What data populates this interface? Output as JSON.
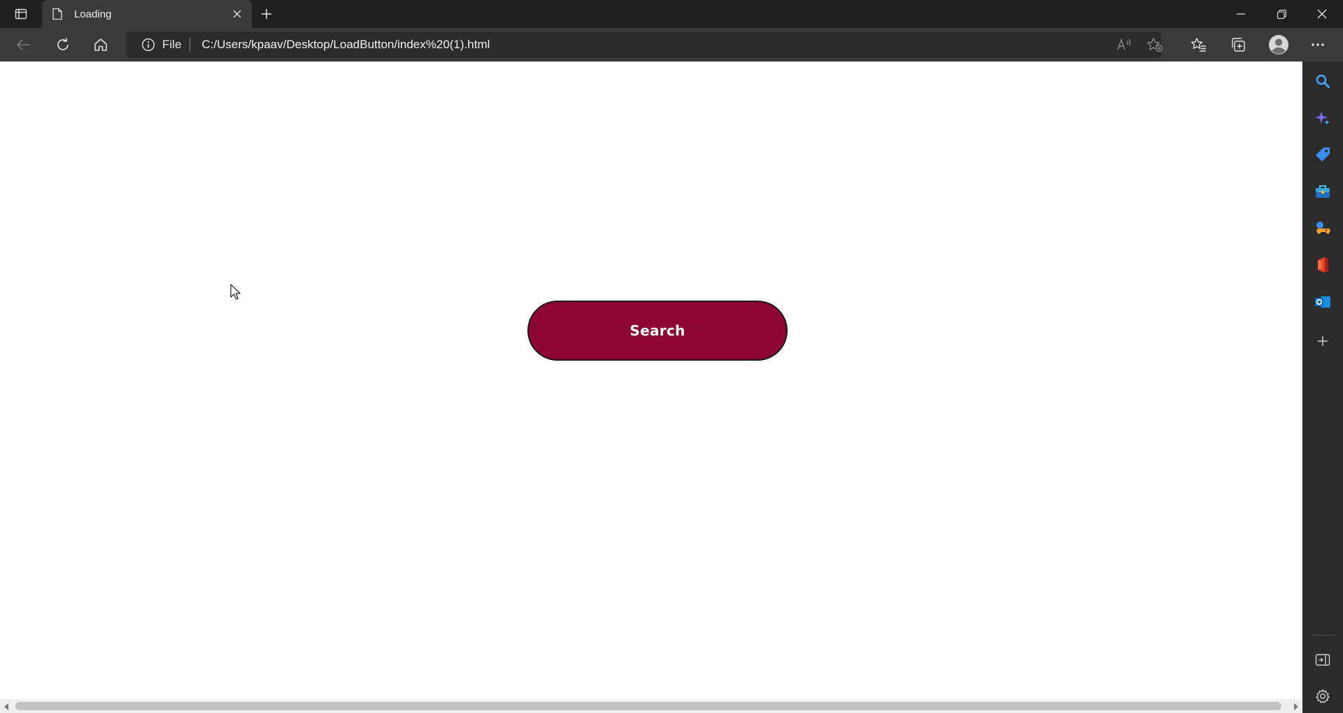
{
  "browser": {
    "tab": {
      "title": "Loading"
    },
    "address": {
      "scheme_label": "File",
      "url": "C:/Users/kpaav/Desktop/LoadButton/index%20(1).html"
    },
    "icons": {
      "tab_actions": "tab-actions-icon",
      "page": "page-icon",
      "close_tab": "close-icon",
      "new_tab": "plus-icon",
      "minimize": "minimize-icon",
      "restore": "restore-icon",
      "close_window": "close-icon",
      "back": "back-arrow-icon",
      "refresh": "refresh-icon",
      "home": "home-icon",
      "info": "info-icon",
      "read_aloud": "read-aloud-icon",
      "add_favorite": "star-plus-icon",
      "favorites": "favorites-icon",
      "collections": "collections-icon",
      "profile": "profile-icon",
      "more": "more-icon"
    },
    "sidebar_icons": [
      "search-icon",
      "copilot-icon",
      "shopping-tag-icon",
      "tools-icon",
      "games-icon",
      "office-icon",
      "outlook-icon",
      "add-icon",
      "hide-sidebar-icon",
      "settings-icon"
    ]
  },
  "page": {
    "search_button_label": "Search"
  },
  "colors": {
    "button_fill": "#8c0533",
    "button_text": "#ffffff",
    "page_background": "#ffffff",
    "chrome_dark": "#202020",
    "toolbar": "#3a3a3a"
  }
}
